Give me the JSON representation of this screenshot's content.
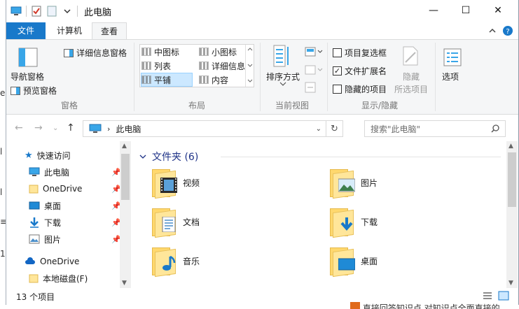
{
  "window": {
    "title": "此电脑",
    "controls": {
      "minimize": "—",
      "maximize": "☐",
      "close": "✕"
    }
  },
  "tabs": {
    "file": "文件",
    "computer": "计算机",
    "view": "查看"
  },
  "ribbon": {
    "panes": {
      "nav_pane": "导航窗格",
      "preview_pane": "预览窗格",
      "details_pane": "详细信息窗格",
      "group_label": "窗格"
    },
    "layout": {
      "items": [
        "中图标",
        "小图标",
        "列表",
        "详细信息",
        "平铺",
        "内容"
      ],
      "selected": "平铺",
      "group_label": "布局"
    },
    "current_view": {
      "sort_by": "排序方式",
      "group_label": "当前视图"
    },
    "show_hide": {
      "item_checkboxes": "项目复选框",
      "file_extensions": "文件扩展名",
      "hidden_items": "隐藏的项目",
      "hide_selected_1": "隐藏",
      "hide_selected_2": "所选项目",
      "group_label": "显示/隐藏"
    },
    "options": {
      "label": "选项"
    }
  },
  "address": {
    "path": "此电脑",
    "search_placeholder": "搜索\"此电脑\""
  },
  "nav": {
    "quick_access": "快速访问",
    "items": [
      "此电脑",
      "OneDrive",
      "桌面",
      "下载",
      "图片"
    ],
    "onedrive": "OneDrive",
    "local_disk": "本地磁盘(F)"
  },
  "content": {
    "group_title": "文件夹 (6)",
    "folders": [
      "视频",
      "图片",
      "文档",
      "下载",
      "音乐",
      "桌面"
    ]
  },
  "status": {
    "count": "13 个项目"
  },
  "background": {
    "left_fragments": [
      "e",
      "l",
      "l",
      "1",
      "≡"
    ],
    "bottom_text": "直接回答知识点 对知识点全面直接的"
  },
  "colors": {
    "accent": "#1979ca",
    "folder_yellow": "#ffd86e",
    "selected_bg": "#cce8ff"
  }
}
